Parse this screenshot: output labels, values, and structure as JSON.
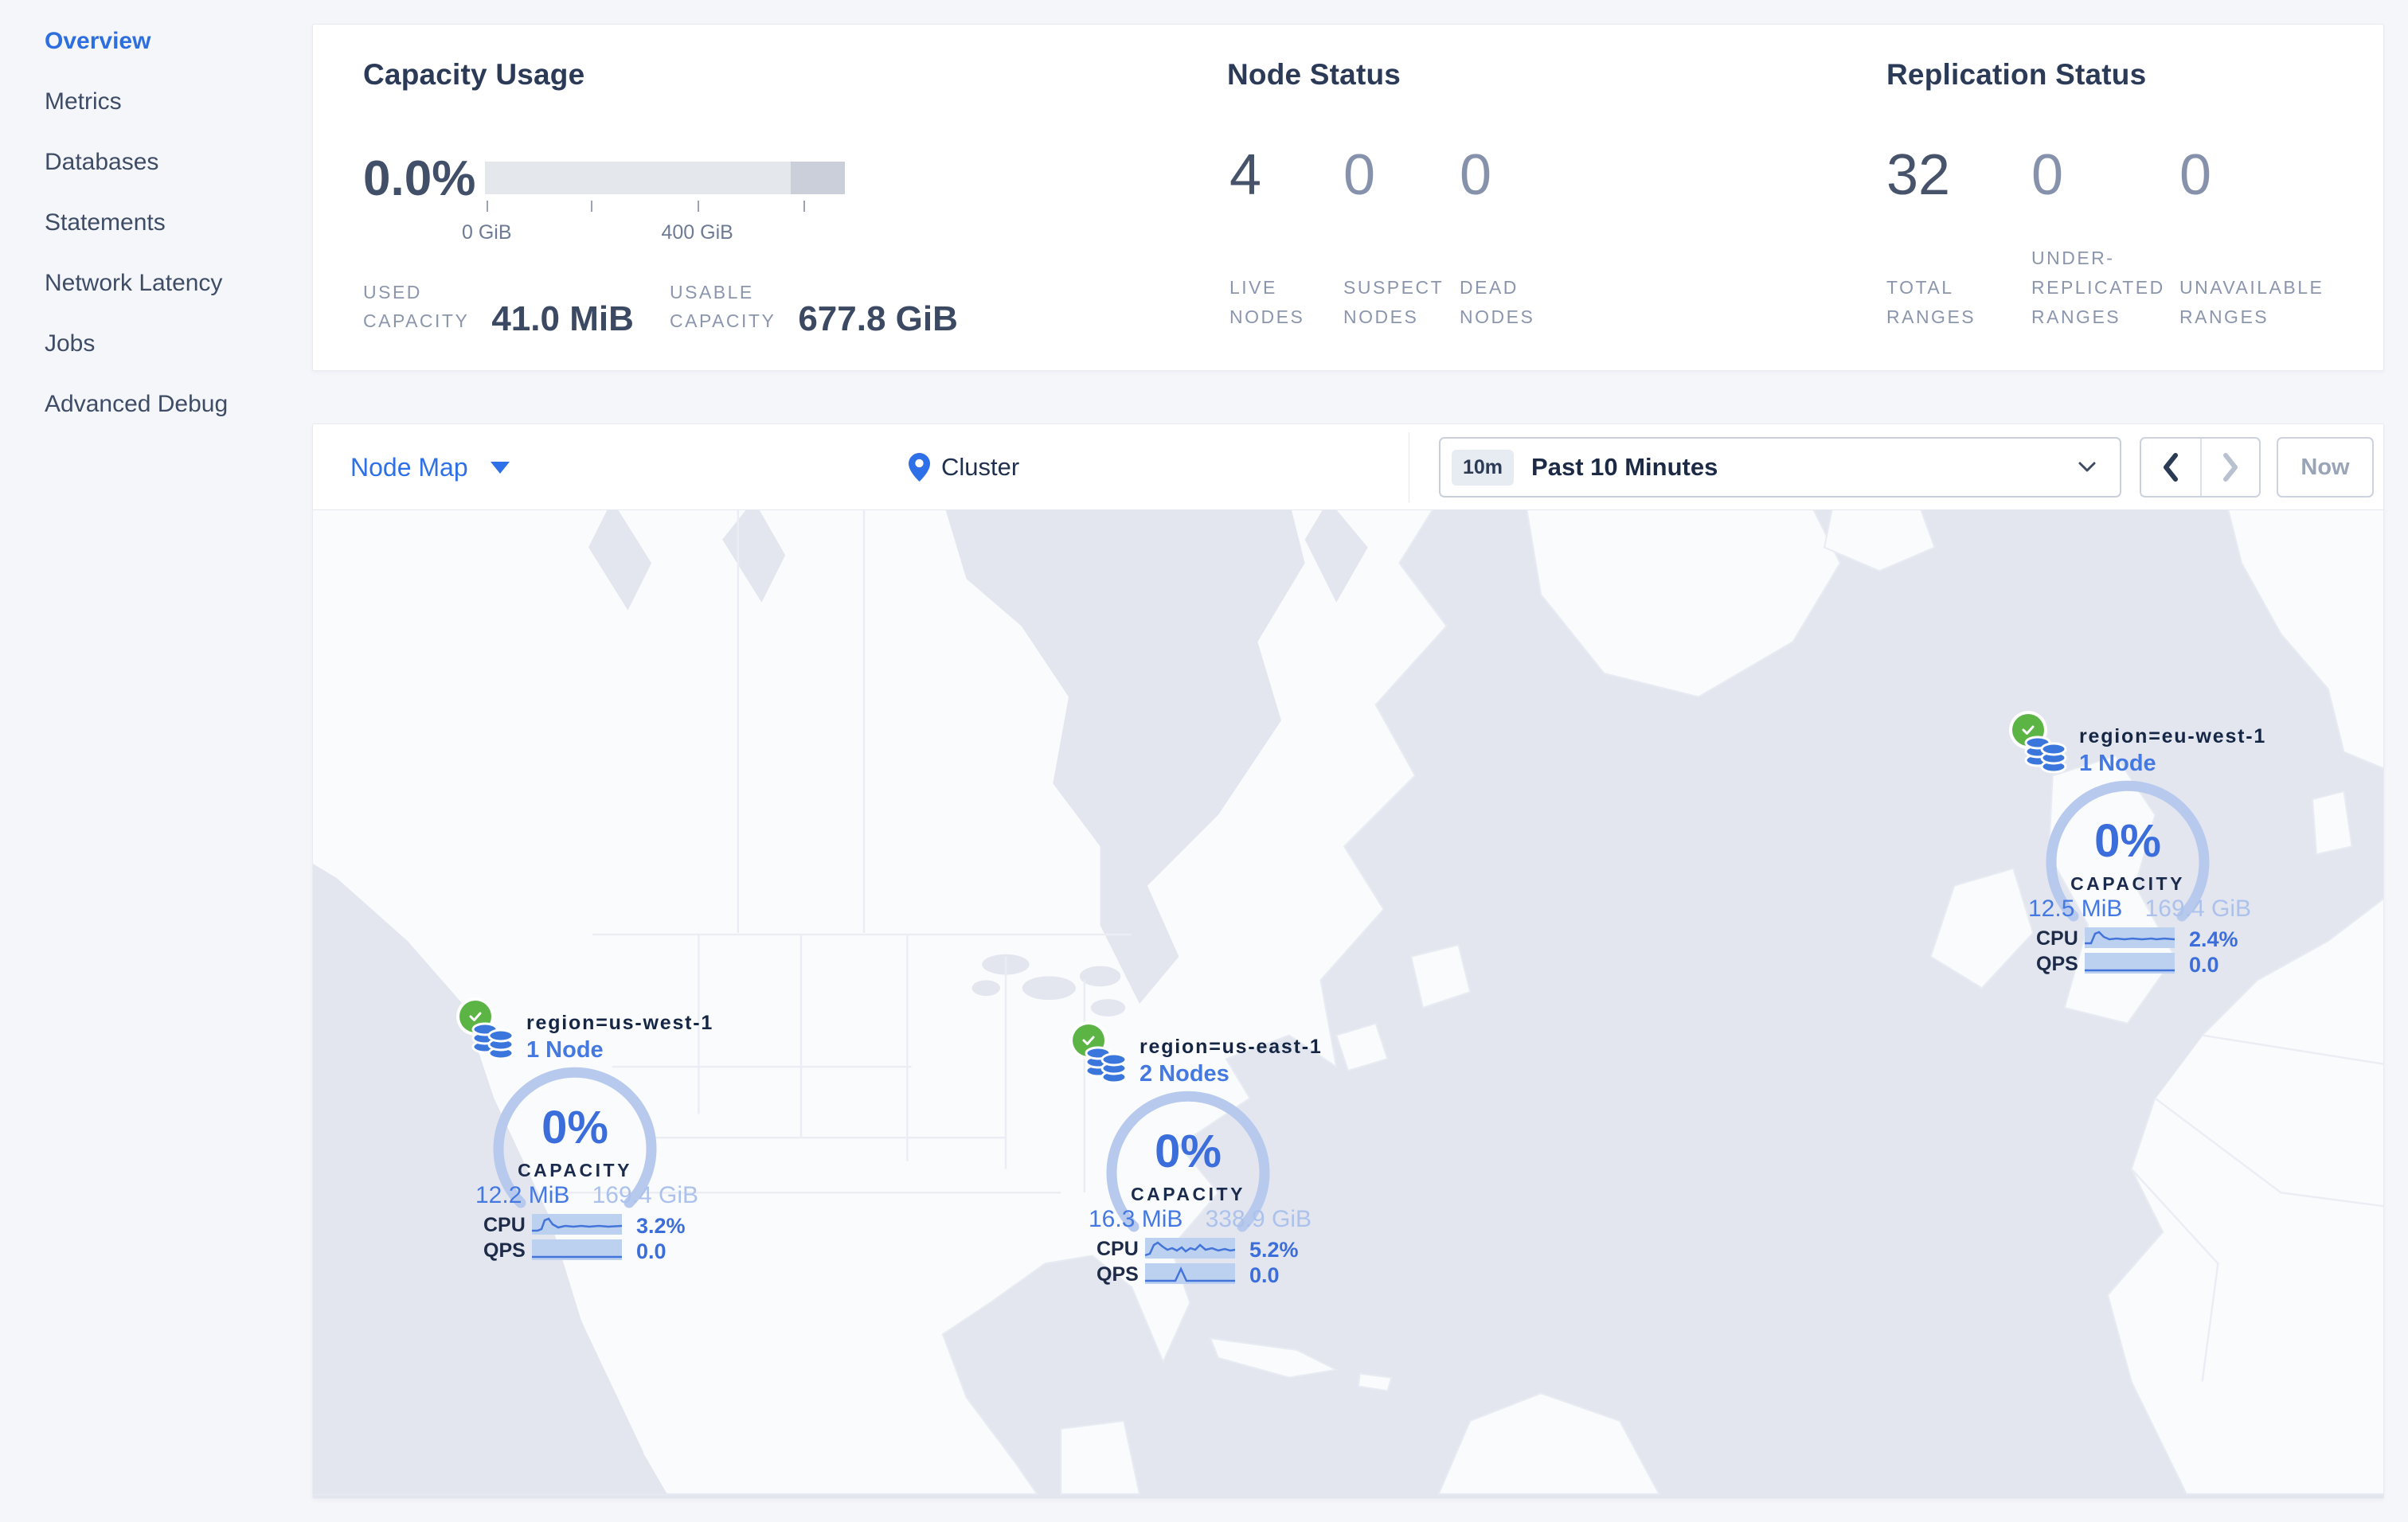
{
  "sidebar": {
    "items": [
      {
        "label": "Overview",
        "active": true
      },
      {
        "label": "Metrics",
        "active": false
      },
      {
        "label": "Databases",
        "active": false
      },
      {
        "label": "Statements",
        "active": false
      },
      {
        "label": "Network Latency",
        "active": false
      },
      {
        "label": "Jobs",
        "active": false
      },
      {
        "label": "Advanced Debug",
        "active": false
      }
    ]
  },
  "stats": {
    "capacity": {
      "title": "Capacity Usage",
      "percent": "0.0%",
      "bar": {
        "ticks": [
          {
            "pct": 0.5,
            "label": "0 GiB"
          },
          {
            "pct": 29.5,
            "label": ""
          },
          {
            "pct": 59.0,
            "label": "400 GiB"
          },
          {
            "pct": 88.5,
            "label": ""
          }
        ],
        "segment": {
          "start_pct": 85,
          "width_pct": 15
        }
      },
      "metrics": [
        {
          "line1": "USED",
          "line2": "CAPACITY",
          "value": "41.0 MiB"
        },
        {
          "line1": "USABLE",
          "line2": "CAPACITY",
          "value": "677.8 GiB"
        }
      ]
    },
    "nodes": {
      "title": "Node Status",
      "cols": [
        {
          "value": "4",
          "line1": "LIVE",
          "line2": "NODES",
          "line3": ""
        },
        {
          "value": "0",
          "line1": "SUSPECT",
          "line2": "NODES",
          "line3": ""
        },
        {
          "value": "0",
          "line1": "DEAD",
          "line2": "NODES",
          "line3": ""
        }
      ]
    },
    "replication": {
      "title": "Replication Status",
      "cols": [
        {
          "value": "32",
          "line1": "TOTAL",
          "line2": "RANGES",
          "line3": ""
        },
        {
          "value": "0",
          "line1": "UNDER-",
          "line2": "REPLICATED",
          "line3": "RANGES"
        },
        {
          "value": "0",
          "line1": "UNAVAILABLE",
          "line2": "RANGES",
          "line3": ""
        }
      ]
    }
  },
  "toolbar": {
    "view_label": "Node Map",
    "breadcrumb": "Cluster",
    "time_badge": "10m",
    "time_label": "Past 10 Minutes",
    "prev_label": "previous time window",
    "next_label": "next time window",
    "now_label": "Now"
  },
  "map_regions": [
    {
      "name": "region=us-west-1",
      "nodes": "1 Node",
      "percent": "0%",
      "gauge_label": "CAPACITY",
      "used": "12.2 MiB",
      "capacity": "169.4 GiB",
      "cpu_label": "CPU",
      "cpu_value": "3.2%",
      "qps_label": "QPS",
      "qps_value": "0.0",
      "cpu_spark": [
        [
          0,
          21
        ],
        [
          7,
          21
        ],
        [
          12,
          19
        ],
        [
          16,
          8
        ],
        [
          21,
          6
        ],
        [
          26,
          13
        ],
        [
          33,
          17
        ],
        [
          42,
          15
        ],
        [
          52,
          16
        ],
        [
          62,
          15
        ],
        [
          72,
          16
        ],
        [
          84,
          15
        ],
        [
          96,
          16
        ],
        [
          113,
          15
        ]
      ],
      "qps_spark": [
        [
          0,
          22
        ],
        [
          113,
          22
        ]
      ]
    },
    {
      "name": "region=us-east-1",
      "nodes": "2 Nodes",
      "percent": "0%",
      "gauge_label": "CAPACITY",
      "used": "16.3 MiB",
      "capacity": "338.9 GiB",
      "cpu_label": "CPU",
      "cpu_value": "5.2%",
      "qps_label": "QPS",
      "qps_value": "0.0",
      "cpu_spark": [
        [
          0,
          22
        ],
        [
          6,
          20
        ],
        [
          11,
          9
        ],
        [
          16,
          6
        ],
        [
          22,
          11
        ],
        [
          28,
          15
        ],
        [
          34,
          13
        ],
        [
          40,
          16
        ],
        [
          46,
          12
        ],
        [
          51,
          17
        ],
        [
          57,
          13
        ],
        [
          63,
          15
        ],
        [
          69,
          9
        ],
        [
          76,
          15
        ],
        [
          84,
          13
        ],
        [
          92,
          16
        ],
        [
          100,
          14
        ],
        [
          107,
          16
        ],
        [
          113,
          15
        ]
      ],
      "qps_spark": [
        [
          0,
          22
        ],
        [
          38,
          22
        ],
        [
          45,
          7
        ],
        [
          52,
          22
        ],
        [
          113,
          22
        ]
      ]
    },
    {
      "name": "region=eu-west-1",
      "nodes": "1 Node",
      "percent": "0%",
      "gauge_label": "CAPACITY",
      "used": "12.5 MiB",
      "capacity": "169.4 GiB",
      "cpu_label": "CPU",
      "cpu_value": "2.4%",
      "qps_label": "QPS",
      "qps_value": "0.0",
      "cpu_spark": [
        [
          0,
          20
        ],
        [
          8,
          20
        ],
        [
          13,
          8
        ],
        [
          18,
          6
        ],
        [
          24,
          12
        ],
        [
          31,
          15
        ],
        [
          40,
          14
        ],
        [
          50,
          15
        ],
        [
          60,
          14
        ],
        [
          72,
          15
        ],
        [
          84,
          14
        ],
        [
          90,
          15
        ],
        [
          100,
          14
        ],
        [
          113,
          15
        ]
      ],
      "qps_spark": [
        [
          0,
          22
        ],
        [
          113,
          22
        ]
      ]
    }
  ],
  "colors": {
    "accent_blue": "#2e70e8",
    "gauge_blue": "#3b6edb",
    "arc_blue": "#b7c9ed",
    "band_blue": "#bcd0f0",
    "ok_green": "#5cb445",
    "ocean": "#e3e6ee",
    "land": "#fafbfd"
  }
}
